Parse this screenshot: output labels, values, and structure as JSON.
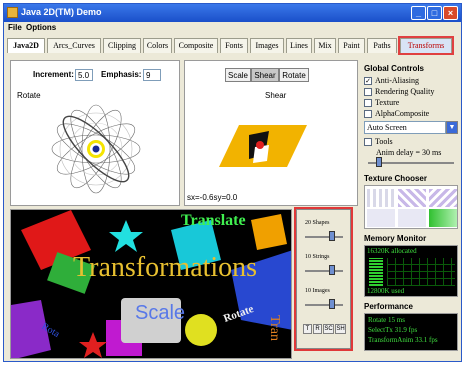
{
  "window": {
    "title": "Java 2D(TM) Demo",
    "controls": [
      "_",
      "□",
      "×"
    ]
  },
  "menu": [
    "File",
    "Options"
  ],
  "tabs": [
    "Java2D",
    "Arcs_Curves",
    "Clipping",
    "Colors",
    "Composite",
    "Fonts",
    "Images",
    "Lines",
    "Mix",
    "Paint",
    "Paths",
    "Transforms"
  ],
  "rotate": {
    "increment_label": "Increment:",
    "increment_value": "5.0",
    "emphasis_label": "Emphasis:",
    "emphasis_value": "9",
    "title": "Rotate"
  },
  "shear": {
    "buttons": [
      "Scale",
      "Shear",
      "Rotate"
    ],
    "title": "Shear",
    "status": "sx=-0.6sy=0.0"
  },
  "transform_ctrl": {
    "shapes_label": "20 Shapes",
    "strings_label": "10 Strings",
    "images_label": "10 Images",
    "buttons": [
      "T",
      "R",
      "SC",
      "SH"
    ]
  },
  "canvas_text": {
    "main": "Transformations",
    "top": "Translate",
    "scale": "Scale",
    "rotate": "Rotate",
    "rotate2": "Rota",
    "trans2": "Tran"
  },
  "global_controls": {
    "title": "Global Controls",
    "options": [
      {
        "label": "Anti-Aliasing",
        "checked": true
      },
      {
        "label": "Rendering Quality",
        "checked": false
      },
      {
        "label": "Texture",
        "checked": false
      },
      {
        "label": "AlphaComposite",
        "checked": false
      }
    ],
    "screen_select": "Auto Screen",
    "tools_label": "Tools",
    "anim_delay": "Anim delay = 30 ms"
  },
  "texture_chooser": {
    "title": "Texture Chooser"
  },
  "memory_monitor": {
    "title": "Memory Monitor",
    "allocated": "16320K allocated",
    "used": "12800K used"
  },
  "performance": {
    "title": "Performance",
    "lines": [
      "Rotate 15 ms",
      "SelectTx 31.9 fps",
      "TransformAnim 33.1 fps"
    ]
  }
}
